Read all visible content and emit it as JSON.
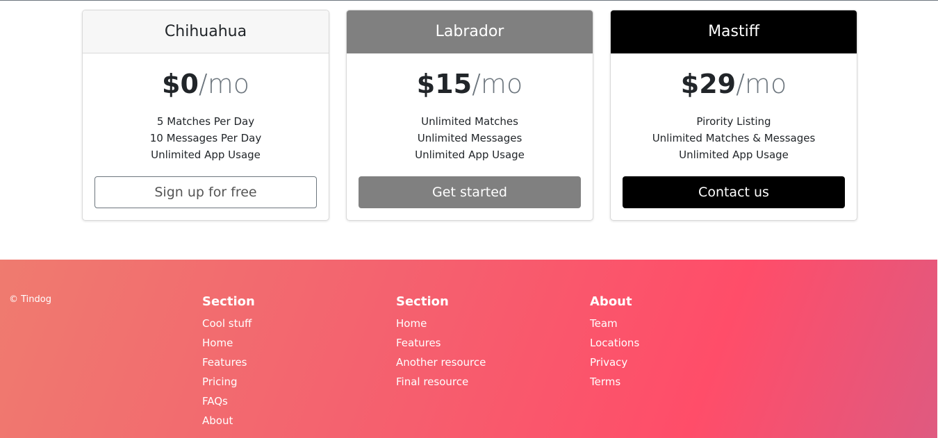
{
  "pricing": {
    "cards": [
      {
        "title": "Chihuahua",
        "price": "$0",
        "per": "/mo",
        "features": [
          "5 Matches Per Day",
          "10 Messages Per Day",
          "Unlimited App Usage"
        ],
        "button": "Sign up for free"
      },
      {
        "title": "Labrador",
        "price": "$15",
        "per": "/mo",
        "features": [
          "Unlimited Matches",
          "Unlimited Messages",
          "Unlimited App Usage"
        ],
        "button": "Get started"
      },
      {
        "title": "Mastiff",
        "price": "$29",
        "per": "/mo",
        "features": [
          "Pirority Listing",
          "Unlimited Matches & Messages",
          "Unlimited App Usage"
        ],
        "button": "Contact us"
      }
    ]
  },
  "footer": {
    "copyright": "© Tindog",
    "columns": [
      {
        "heading": "Section",
        "links": [
          "Cool stuff",
          "Home",
          "Features",
          "Pricing",
          "FAQs",
          "About"
        ]
      },
      {
        "heading": "Section",
        "links": [
          "Home",
          "Features",
          "Another resource",
          "Final resource"
        ]
      },
      {
        "heading": "About",
        "links": [
          "Team",
          "Locations",
          "Privacy",
          "Terms"
        ]
      }
    ]
  },
  "colors": {
    "footer_gradient": [
      "#ef7b6f",
      "#ff4d69",
      "#df5a80"
    ],
    "card_2_header": "#808080",
    "card_3_header": "#000000"
  }
}
